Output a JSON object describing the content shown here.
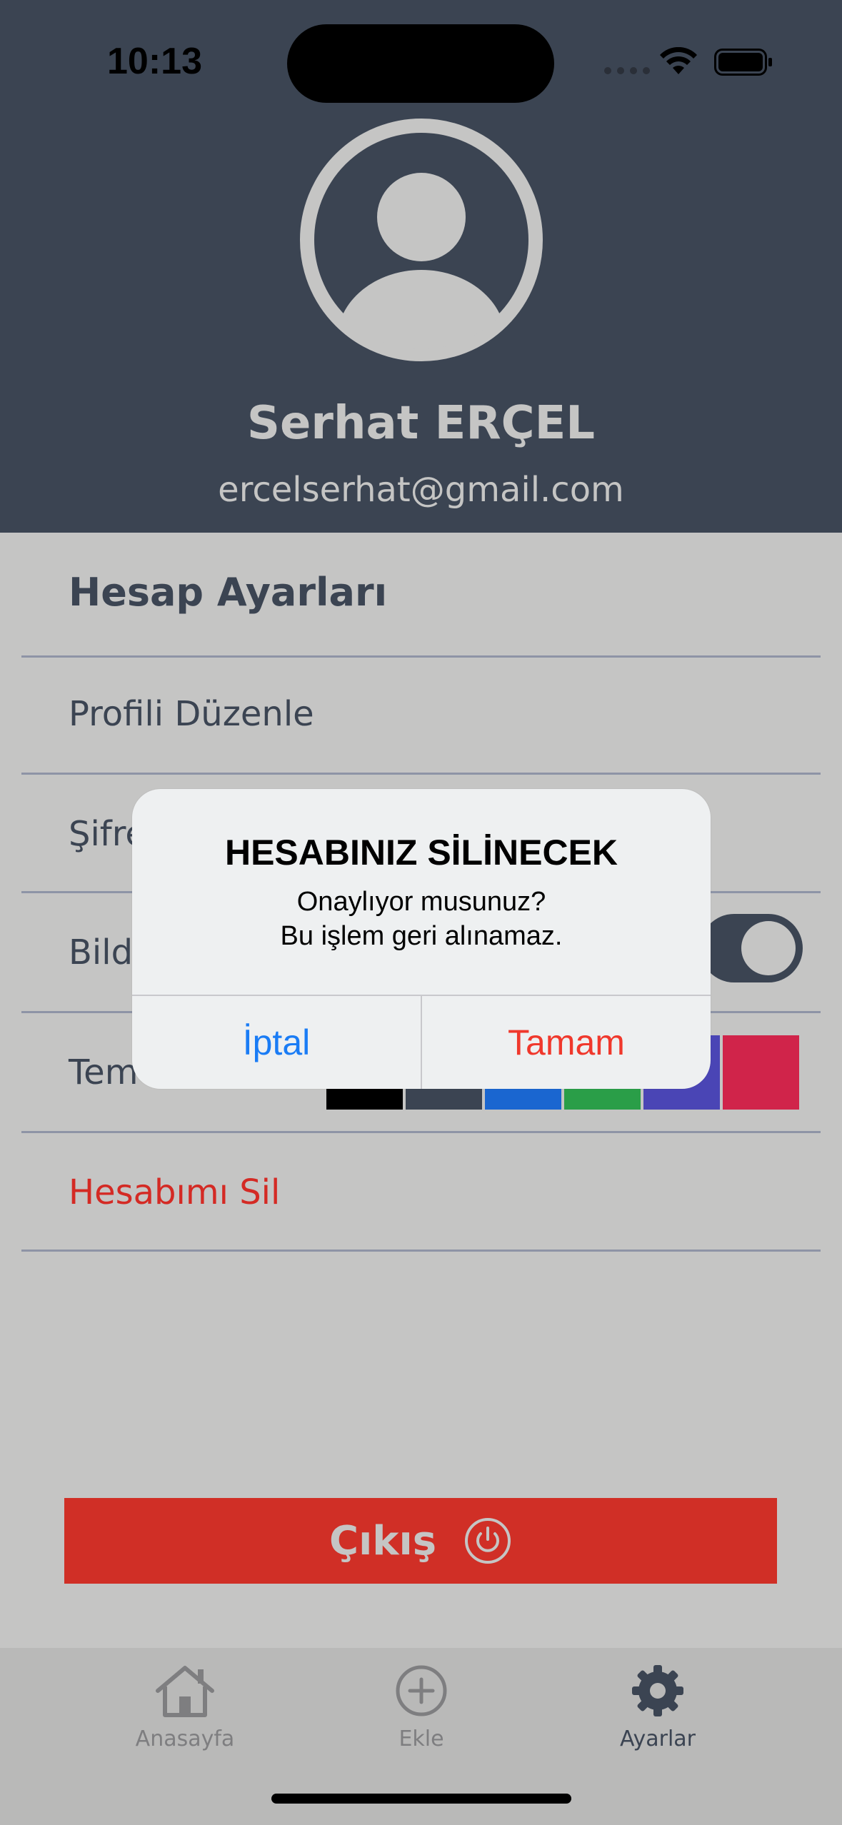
{
  "status_bar": {
    "time": "10:13"
  },
  "profile": {
    "name": "Serhat ERÇEL",
    "email": "ercelserhat@gmail.com"
  },
  "settings": {
    "section_title": "Hesap Ayarları",
    "rows": [
      {
        "label": "Profili Düzenle"
      },
      {
        "label": "Şifre"
      },
      {
        "label": "Bild",
        "toggle_on": true
      },
      {
        "label": "Tem"
      },
      {
        "label": "Hesabımı Sil"
      }
    ],
    "theme_colors": [
      "#c5c5c4",
      "#000000",
      "#3b4452",
      "#1a66d0",
      "#2a9e48",
      "#4a45b5",
      "#d0244a"
    ]
  },
  "exit_button": {
    "label": "Çıkış",
    "icon": "power-icon"
  },
  "tabbar": {
    "items": [
      {
        "label": "Anasayfa",
        "icon": "home-icon",
        "active": false
      },
      {
        "label": "Ekle",
        "icon": "add-circle-icon",
        "active": false
      },
      {
        "label": "Ayarlar",
        "icon": "gear-icon",
        "active": true
      }
    ]
  },
  "dialog": {
    "title": "HESABINIZ SİLİNECEK",
    "message": "Onaylıyor musunuz?\nBu işlem geri alınamaz.",
    "cancel_label": "İptal",
    "confirm_label": "Tamam"
  },
  "colors": {
    "header_bg": "#3b4452",
    "page_bg": "#c5c5c4",
    "danger": "#d02f26",
    "ios_blue": "#1a7cf5",
    "ios_red": "#f0382c"
  }
}
